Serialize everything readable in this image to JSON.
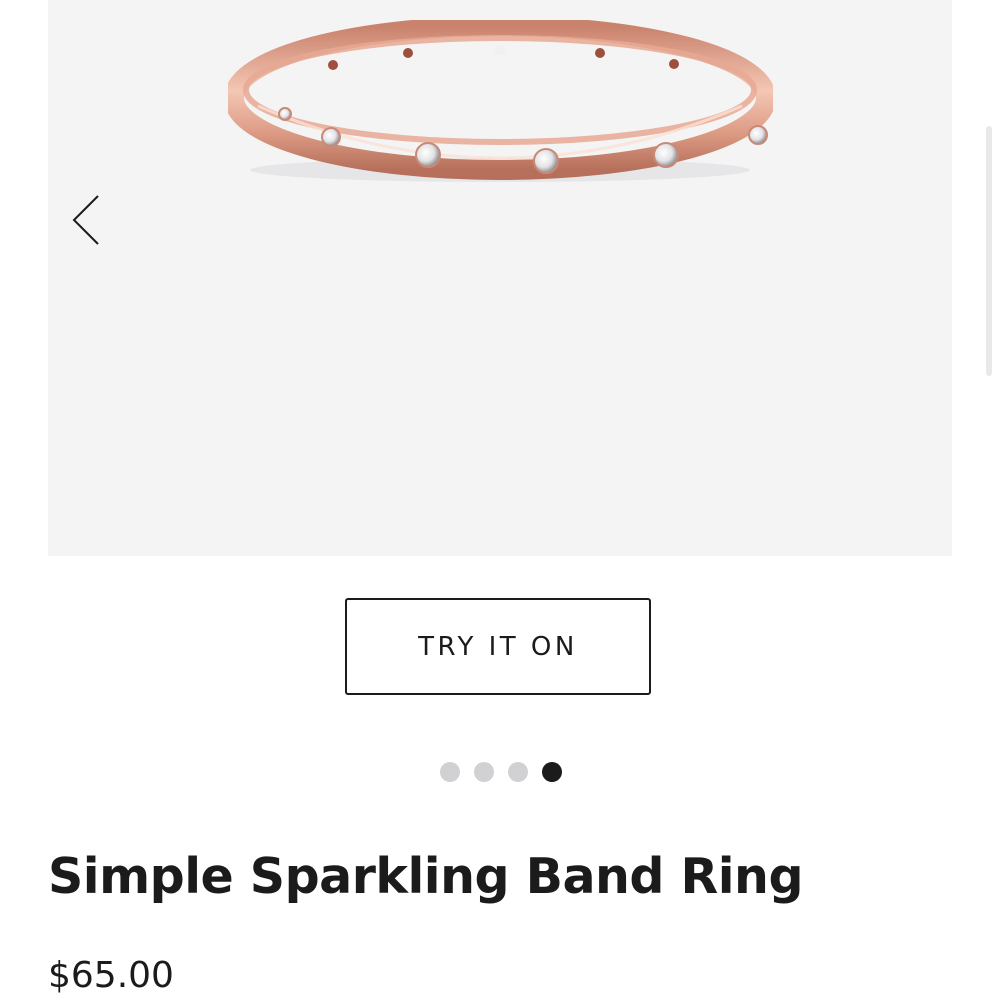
{
  "gallery": {
    "image_alt": "Simple Sparkling Band Ring",
    "prev_icon": "chevron-left-icon",
    "background_color": "#f4f4f5"
  },
  "try_on": {
    "label": "TRY IT ON"
  },
  "carousel": {
    "slide_count": 4,
    "active_slide": 4
  },
  "product": {
    "title": "Simple Sparkling Band Ring",
    "price": "$65.00"
  },
  "colors": {
    "ring": "#d99a84",
    "text": "#1b1b1b",
    "dot_inactive": "#d1d1d3",
    "dot_active": "#1b1b1b"
  }
}
